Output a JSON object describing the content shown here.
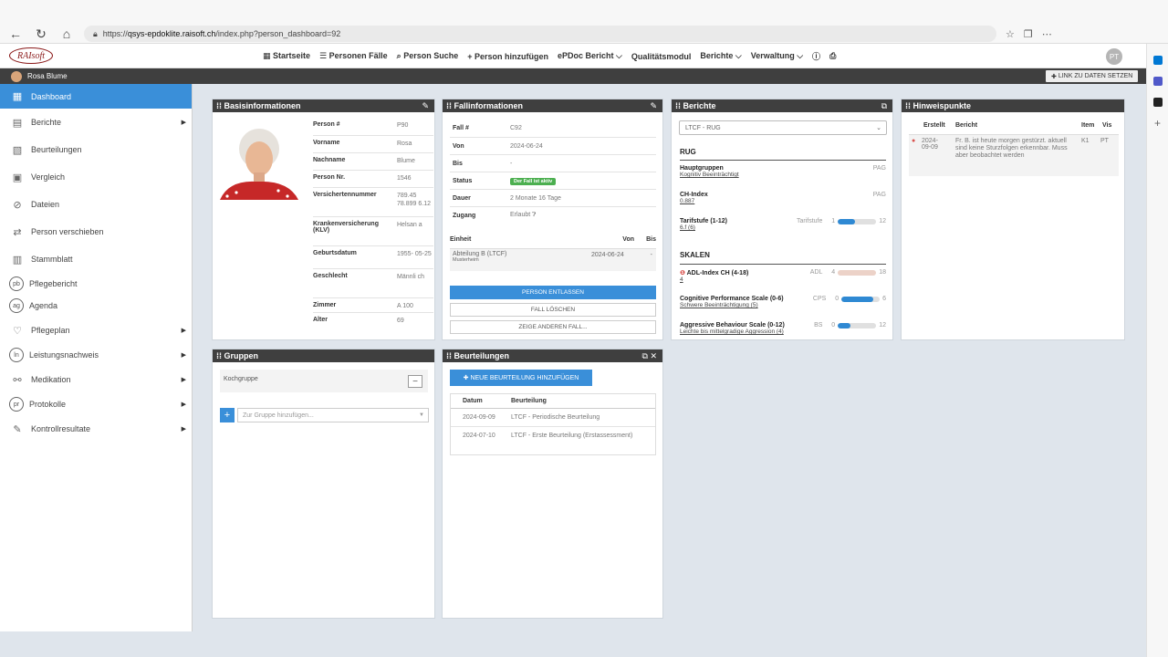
{
  "browser": {
    "url_prefix": "https://",
    "url_domain": "qsys-epdoklite.raisoft.ch",
    "url_path": "/index.php?person_dashboard=92"
  },
  "app": {
    "logo": "RAIsoft",
    "avatar": "PT"
  },
  "menu": [
    "Startseite",
    "Personen Fälle",
    "Person Suche",
    "Person hinzufügen",
    "ePDoc Bericht ⌵",
    "Qualitätsmodul",
    "Berichte ⌵",
    "Verwaltung ⌵"
  ],
  "patientbar": {
    "name": "Rosa Blume",
    "link_btn": "LINK ZU DATEN SETZEN"
  },
  "sidebar": [
    {
      "label": "Dashboard",
      "icon": "dashboard-icon"
    },
    {
      "label": "Berichte",
      "icon": "report-icon",
      "arrow": true
    },
    {
      "label": "Beurteilungen",
      "icon": "assessment-icon"
    },
    {
      "label": "Vergleich",
      "icon": "compare-icon"
    },
    {
      "label": "Dateien",
      "icon": "paperclip-icon"
    },
    {
      "label": "Person verschieben",
      "icon": "transfer-icon"
    },
    {
      "label": "Stammblatt",
      "icon": "card-icon"
    },
    {
      "label": "Pflegebericht",
      "icon": "pb"
    },
    {
      "label": "Agenda",
      "icon": "ag"
    },
    {
      "label": "Pflegeplan",
      "icon": "heart-icon",
      "arrow": true
    },
    {
      "label": "Leistungsnachweis",
      "icon": "ln",
      "arrow": true
    },
    {
      "label": "Medikation",
      "icon": "pills-icon",
      "arrow": true
    },
    {
      "label": "Protokolle",
      "icon": "pr",
      "arrow": true
    },
    {
      "label": "Kontrollresultate",
      "icon": "pen-icon",
      "arrow": true
    }
  ],
  "basis": {
    "title": "Basisinformationen",
    "rows": [
      {
        "k": "Person #",
        "v": "P90"
      },
      {
        "k": "Vorname",
        "v": "Rosa"
      },
      {
        "k": "Nachname",
        "v": "Blume"
      },
      {
        "k": "Person Nr.",
        "v": "1546"
      },
      {
        "k": "Versichertennummer",
        "v": "789.45 78.899 6.12"
      },
      {
        "k": "Krankenversicherung (KLV)",
        "v": "Helsan a"
      },
      {
        "k": "Geburtsdatum",
        "v": "1955- 05-25"
      },
      {
        "k": "Geschlecht",
        "v": "Männli ch"
      },
      {
        "k": "Zimmer",
        "v": "A 100"
      },
      {
        "k": "Alter",
        "v": "69"
      }
    ]
  },
  "fall": {
    "title": "Fallinformationen",
    "rows": [
      {
        "k": "Fall #",
        "v": "C92"
      },
      {
        "k": "Von",
        "v": "2024-06-24"
      },
      {
        "k": "Bis",
        "v": "-"
      },
      {
        "k": "Status",
        "v": "Der Fall ist aktiv"
      },
      {
        "k": "Dauer",
        "v": "2 Monate 16 Tage"
      },
      {
        "k": "Zugang",
        "v": "Erlaubt"
      }
    ],
    "unit_head": {
      "einheit": "Einheit",
      "von": "Von",
      "bis": "Bis"
    },
    "unit": {
      "name": "Abteilung B (LTCF)",
      "sub": "Musterheim",
      "von": "2024-06-24",
      "bis": "-"
    },
    "btn_entlassen": "PERSON ENTLASSEN",
    "btn_loeschen": "FALL LÖSCHEN",
    "btn_andere": "ZEIGE ANDEREN FALL..."
  },
  "berichte": {
    "title": "Berichte",
    "select": "LTCF - RUG",
    "rug": "RUG",
    "haupt_label": "Hauptgruppen",
    "haupt_code": "PAG",
    "haupt_val": "Kognitiv Beeinträchtigt",
    "ch_label": "CH-Index",
    "ch_code": "PAG",
    "ch_val": "0.887",
    "tarif_label": "Tarifstufe (1-12)",
    "tarif_code": "Tarifstufe",
    "tarif_min": "1",
    "tarif_max": "12",
    "tarif_val": "6.f (6)",
    "tarif_level": 0.45,
    "skalen": "SKALEN",
    "adl_label": "ADL-Index CH (4-18)",
    "adl_code": "ADL",
    "adl_min": "4",
    "adl_max": "18",
    "adl_val": "4",
    "adl_level": 0.0,
    "cps_label": "Cognitive Performance Scale (0-6)",
    "cps_code": "CPS",
    "cps_min": "0",
    "cps_max": "6",
    "cps_val": "Schwere Beeinträchtigung (5)",
    "cps_level": 0.83,
    "abs_label": "Aggressive Behaviour Scale (0-12)",
    "abs_code": "BS",
    "abs_min": "0",
    "abs_max": "12",
    "abs_val": "Leichte bis mittelgradige Aggression (4)",
    "abs_level": 0.33
  },
  "hinweis": {
    "title": "Hinweispunkte",
    "cols": [
      "Erstellt",
      "Bericht",
      "Item",
      "Vis"
    ],
    "row": {
      "date": "2024- 09-09",
      "text": "Fr. B. ist heute morgen gestürzt. aktuell sind keine Sturzfolgen erkennbar. Muss aber beobachtet werden",
      "item": "K1",
      "vis": "PT"
    }
  },
  "gruppen": {
    "title": "Gruppen",
    "item": "Kochgruppe",
    "placeholder": "Zur Gruppe hinzufügen..."
  },
  "beurteil": {
    "title": "Beurteilungen",
    "add": "NEUE BEURTEILUNG HINZUFÜGEN",
    "cols": [
      "Datum",
      "Beurteilung"
    ],
    "rows": [
      {
        "d": "2024-09-09",
        "b": "LTCF - Periodische Beurteilung"
      },
      {
        "d": "2024-07-10",
        "b": "LTCF - Erste Beurteilung (Erstassessment)"
      }
    ]
  },
  "colors": {
    "accent": "#3a8fd9",
    "dark": "#3f3f3f",
    "green": "#4caf50",
    "adl": "#e8c4b8",
    "alert": "#d9534f"
  }
}
